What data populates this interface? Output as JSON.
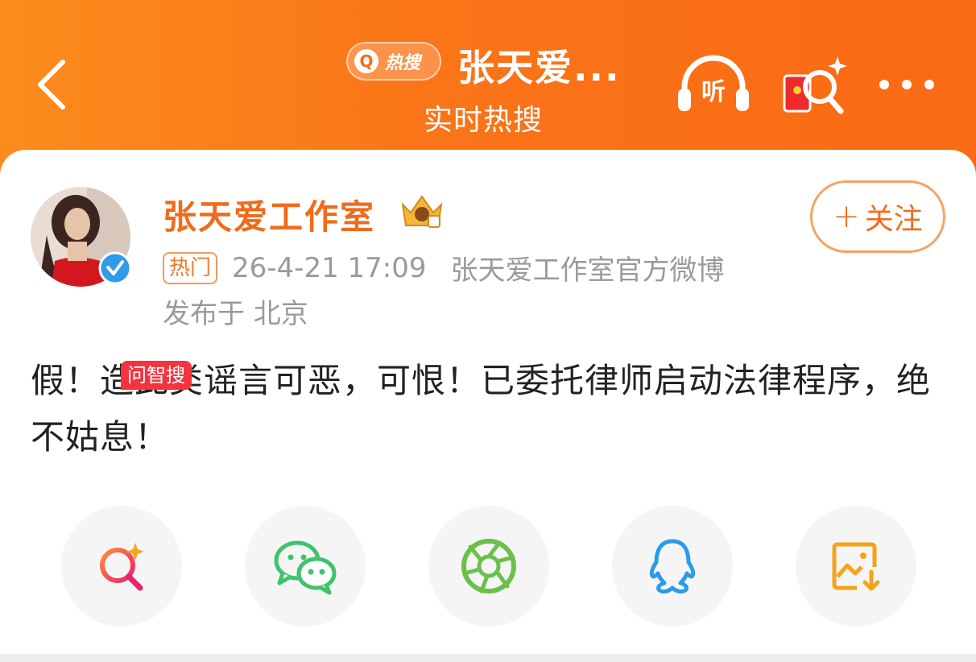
{
  "header": {
    "hot_badge_label": "热搜",
    "title": "张天爱...",
    "subtitle": "实时热搜",
    "listen_label": "听"
  },
  "post": {
    "author_name": "张天爱工作室",
    "follow_label": "关注",
    "hot_tag": "热门",
    "timestamp": "26-4-21 17:09",
    "source": "张天爱工作室官方微博",
    "location": "发布于 北京",
    "text": "假！造此类谣言可恶，可恨！已委托律师启动法律程序，绝不姑息！"
  },
  "share": {
    "ai_tag": "问智搜",
    "items": [
      {
        "icon": "ai-search-icon"
      },
      {
        "icon": "wechat-icon"
      },
      {
        "icon": "moments-icon"
      },
      {
        "icon": "qq-icon"
      },
      {
        "icon": "save-image-icon"
      }
    ]
  },
  "colors": {
    "header_orange": "#fa7418",
    "author_orange": "#f06b1a",
    "follow_border": "#f5a461",
    "wechat_green": "#3fc36b",
    "qq_blue": "#2b9be8",
    "ai_red": "#f3343f"
  }
}
